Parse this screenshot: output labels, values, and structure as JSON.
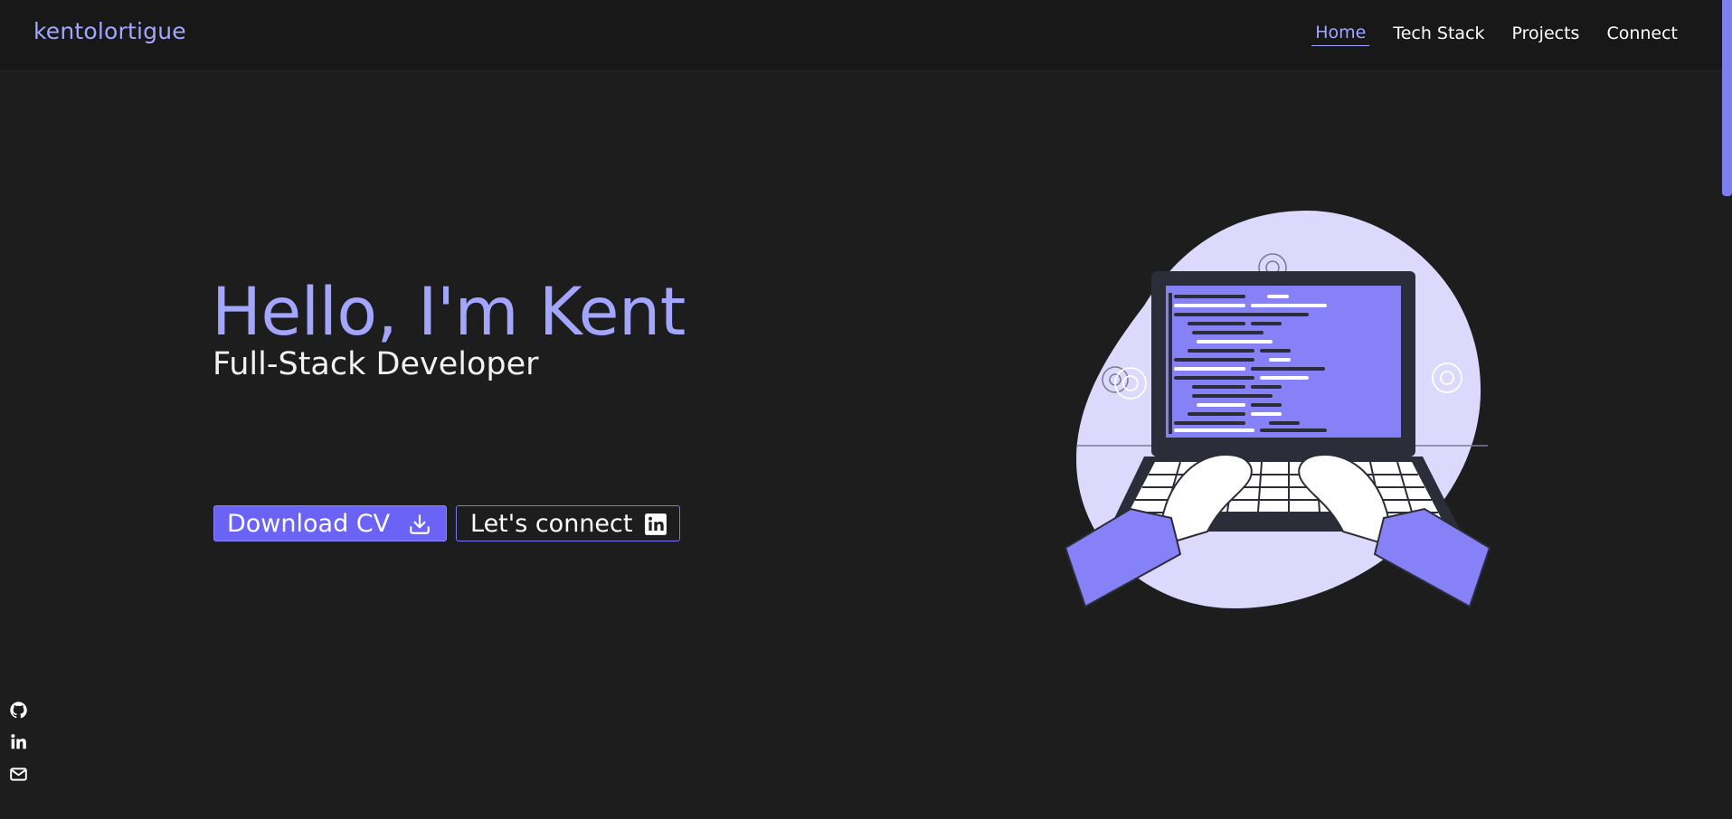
{
  "brand": {
    "name": "kentolortigue"
  },
  "nav": {
    "items": [
      {
        "label": "Home",
        "active": true
      },
      {
        "label": "Tech Stack",
        "active": false
      },
      {
        "label": "Projects",
        "active": false
      },
      {
        "label": "Connect",
        "active": false
      }
    ]
  },
  "hero": {
    "title": "Hello, I'm Kent",
    "subtitle": "Full-Stack Developer",
    "buttons": {
      "download_cv": {
        "label": "Download CV",
        "icon": "download-icon"
      },
      "connect": {
        "label": "Let's connect",
        "icon": "linkedin-icon"
      }
    }
  },
  "side_social": {
    "icons": [
      "github-icon",
      "linkedin-icon",
      "mail-icon"
    ]
  },
  "colors": {
    "background": "#1d1d1d",
    "navbar": "#181818",
    "accent": "#a3a6ff",
    "button_primary": "#6a63f6",
    "illustration_blob": "#dcd9fd",
    "screen": "#8781f8"
  }
}
